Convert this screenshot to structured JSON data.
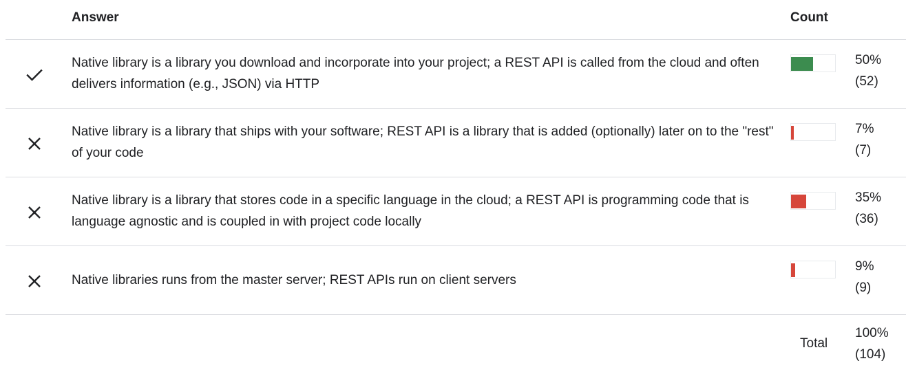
{
  "header": {
    "answer_label": "Answer",
    "count_label": "Count"
  },
  "colors": {
    "correct": "#3c8c4f",
    "incorrect": "#d6463a",
    "divider": "#dadce0"
  },
  "rows": [
    {
      "correct": true,
      "icon": "check-icon",
      "text": "Native library is a library you download and incorporate into your project; a REST API is called from the cloud and often delivers information (e.g., JSON) via HTTP",
      "percent_label": "50%",
      "count_label": "(52)",
      "fraction": 0.5
    },
    {
      "correct": false,
      "icon": "close-icon",
      "text": "Native library is a library that ships with your software; REST API is a library that is added (optionally) later on to the \"rest\" of your code",
      "percent_label": "7%",
      "count_label": "(7)",
      "fraction": 0.07
    },
    {
      "correct": false,
      "icon": "close-icon",
      "text": "Native library is a library that stores code in a specific language in the cloud; a REST API is programming code that is language agnostic and is coupled in with project code locally",
      "percent_label": "35%",
      "count_label": "(36)",
      "fraction": 0.35
    },
    {
      "correct": false,
      "icon": "close-icon",
      "text": "Native libraries runs from the master server; REST APIs run on client servers",
      "percent_label": "9%",
      "count_label": "(9)",
      "fraction": 0.09
    }
  ],
  "total": {
    "label": "Total",
    "percent_label": "100%",
    "count_label": "(104)"
  }
}
